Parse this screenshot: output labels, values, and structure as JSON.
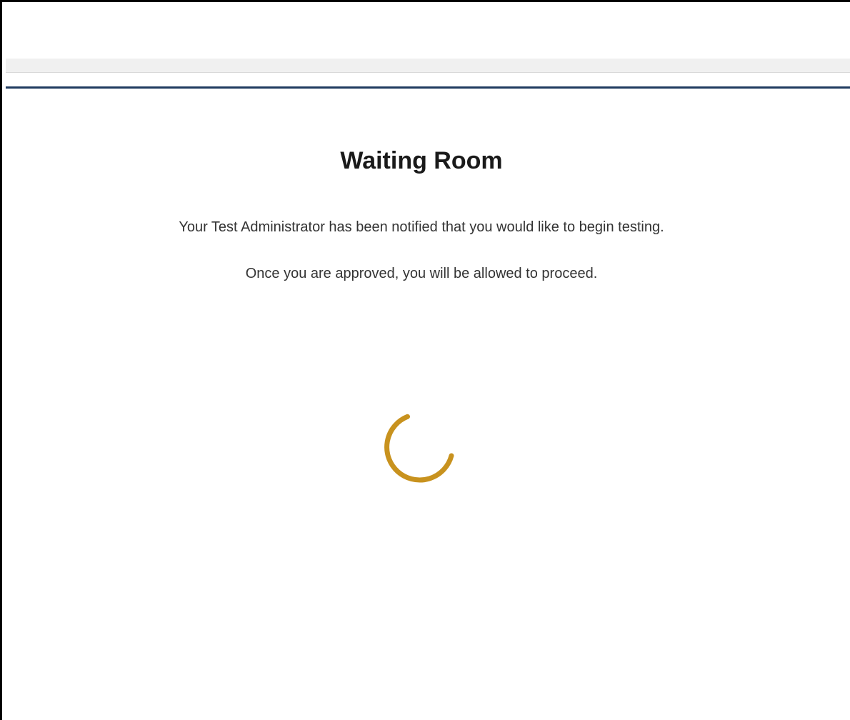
{
  "waiting_room": {
    "title": "Waiting Room",
    "message_notified": "Your Test Administrator has been notified that you would like to begin testing.",
    "message_approval": "Once you are approved, you will be allowed to proceed."
  },
  "colors": {
    "spinner": "#c8921e",
    "header_rule": "#1f3a5f",
    "header_strip": "#f0f0f0"
  },
  "icons": {
    "spinner": "loading-spinner-icon"
  }
}
